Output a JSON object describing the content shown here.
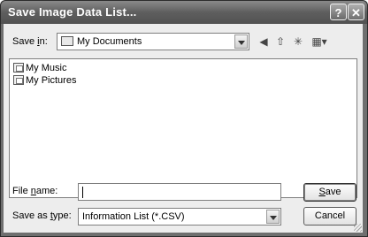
{
  "dialog": {
    "title": "Save Image Data List...",
    "help_glyph": "?",
    "close_glyph": "✕"
  },
  "save_in": {
    "label_pre": "Save ",
    "label_key": "i",
    "label_post": "n:",
    "value": "My Documents"
  },
  "toolbar": {
    "back_glyph": "◀",
    "up_glyph": "⇧",
    "new_folder_glyph": "✳",
    "views_glyph": "▦▾"
  },
  "files": [
    {
      "name": "My Music"
    },
    {
      "name": "My Pictures"
    }
  ],
  "file_name": {
    "label_pre": "File ",
    "label_key": "n",
    "label_post": "ame:",
    "value": ""
  },
  "save_as_type": {
    "label_pre": "Save as ",
    "label_key": "t",
    "label_post": "ype:",
    "value": "Information List (*.CSV)"
  },
  "buttons": {
    "save_key": "S",
    "save_rest": "ave",
    "cancel": "Cancel"
  }
}
